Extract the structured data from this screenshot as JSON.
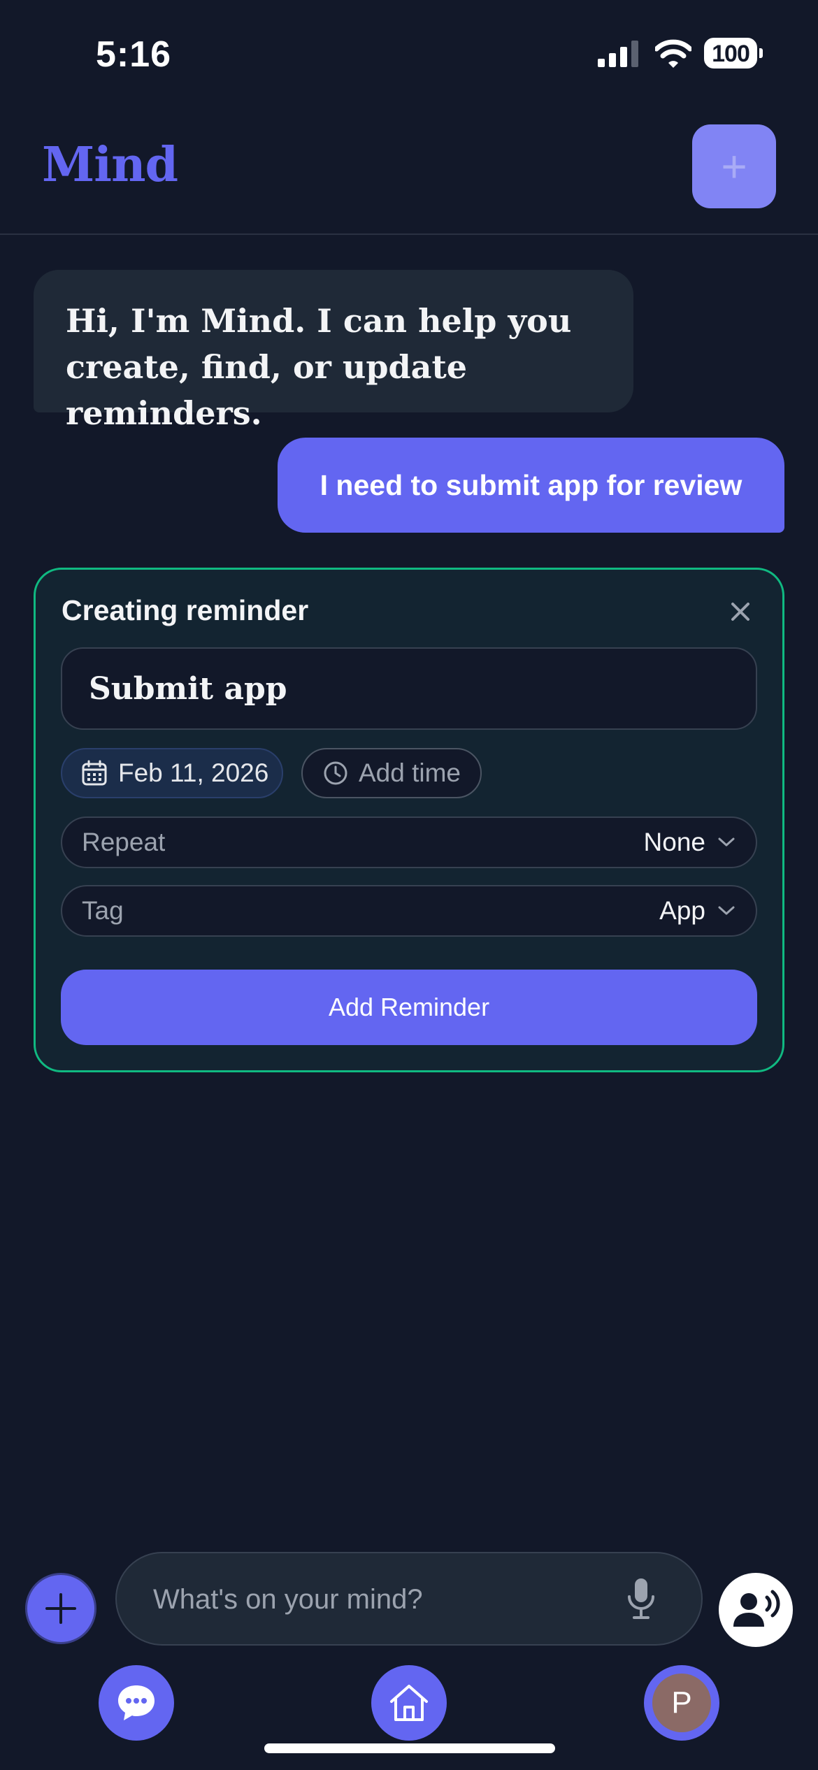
{
  "status_bar": {
    "time": "5:16",
    "battery": "100"
  },
  "header": {
    "brand": "Mind",
    "add_icon": "plus-icon"
  },
  "chat": {
    "bot_message": "Hi, I'm Mind. I can help you create, find, or update reminders.",
    "user_message": "I need to submit app for review"
  },
  "reminder_card": {
    "title": "Creating reminder",
    "name_value": "Submit app",
    "date": "Feb 11, 2026",
    "time_placeholder": "Add time",
    "repeat_label": "Repeat",
    "repeat_value": "None",
    "tag_label": "Tag",
    "tag_value": "App",
    "submit_label": "Add Reminder"
  },
  "composer": {
    "placeholder": "What's on your mind?"
  },
  "nav": {
    "profile_initial": "P"
  },
  "colors": {
    "accent": "#6366f1",
    "card_border": "#10b981",
    "background": "#121829"
  }
}
